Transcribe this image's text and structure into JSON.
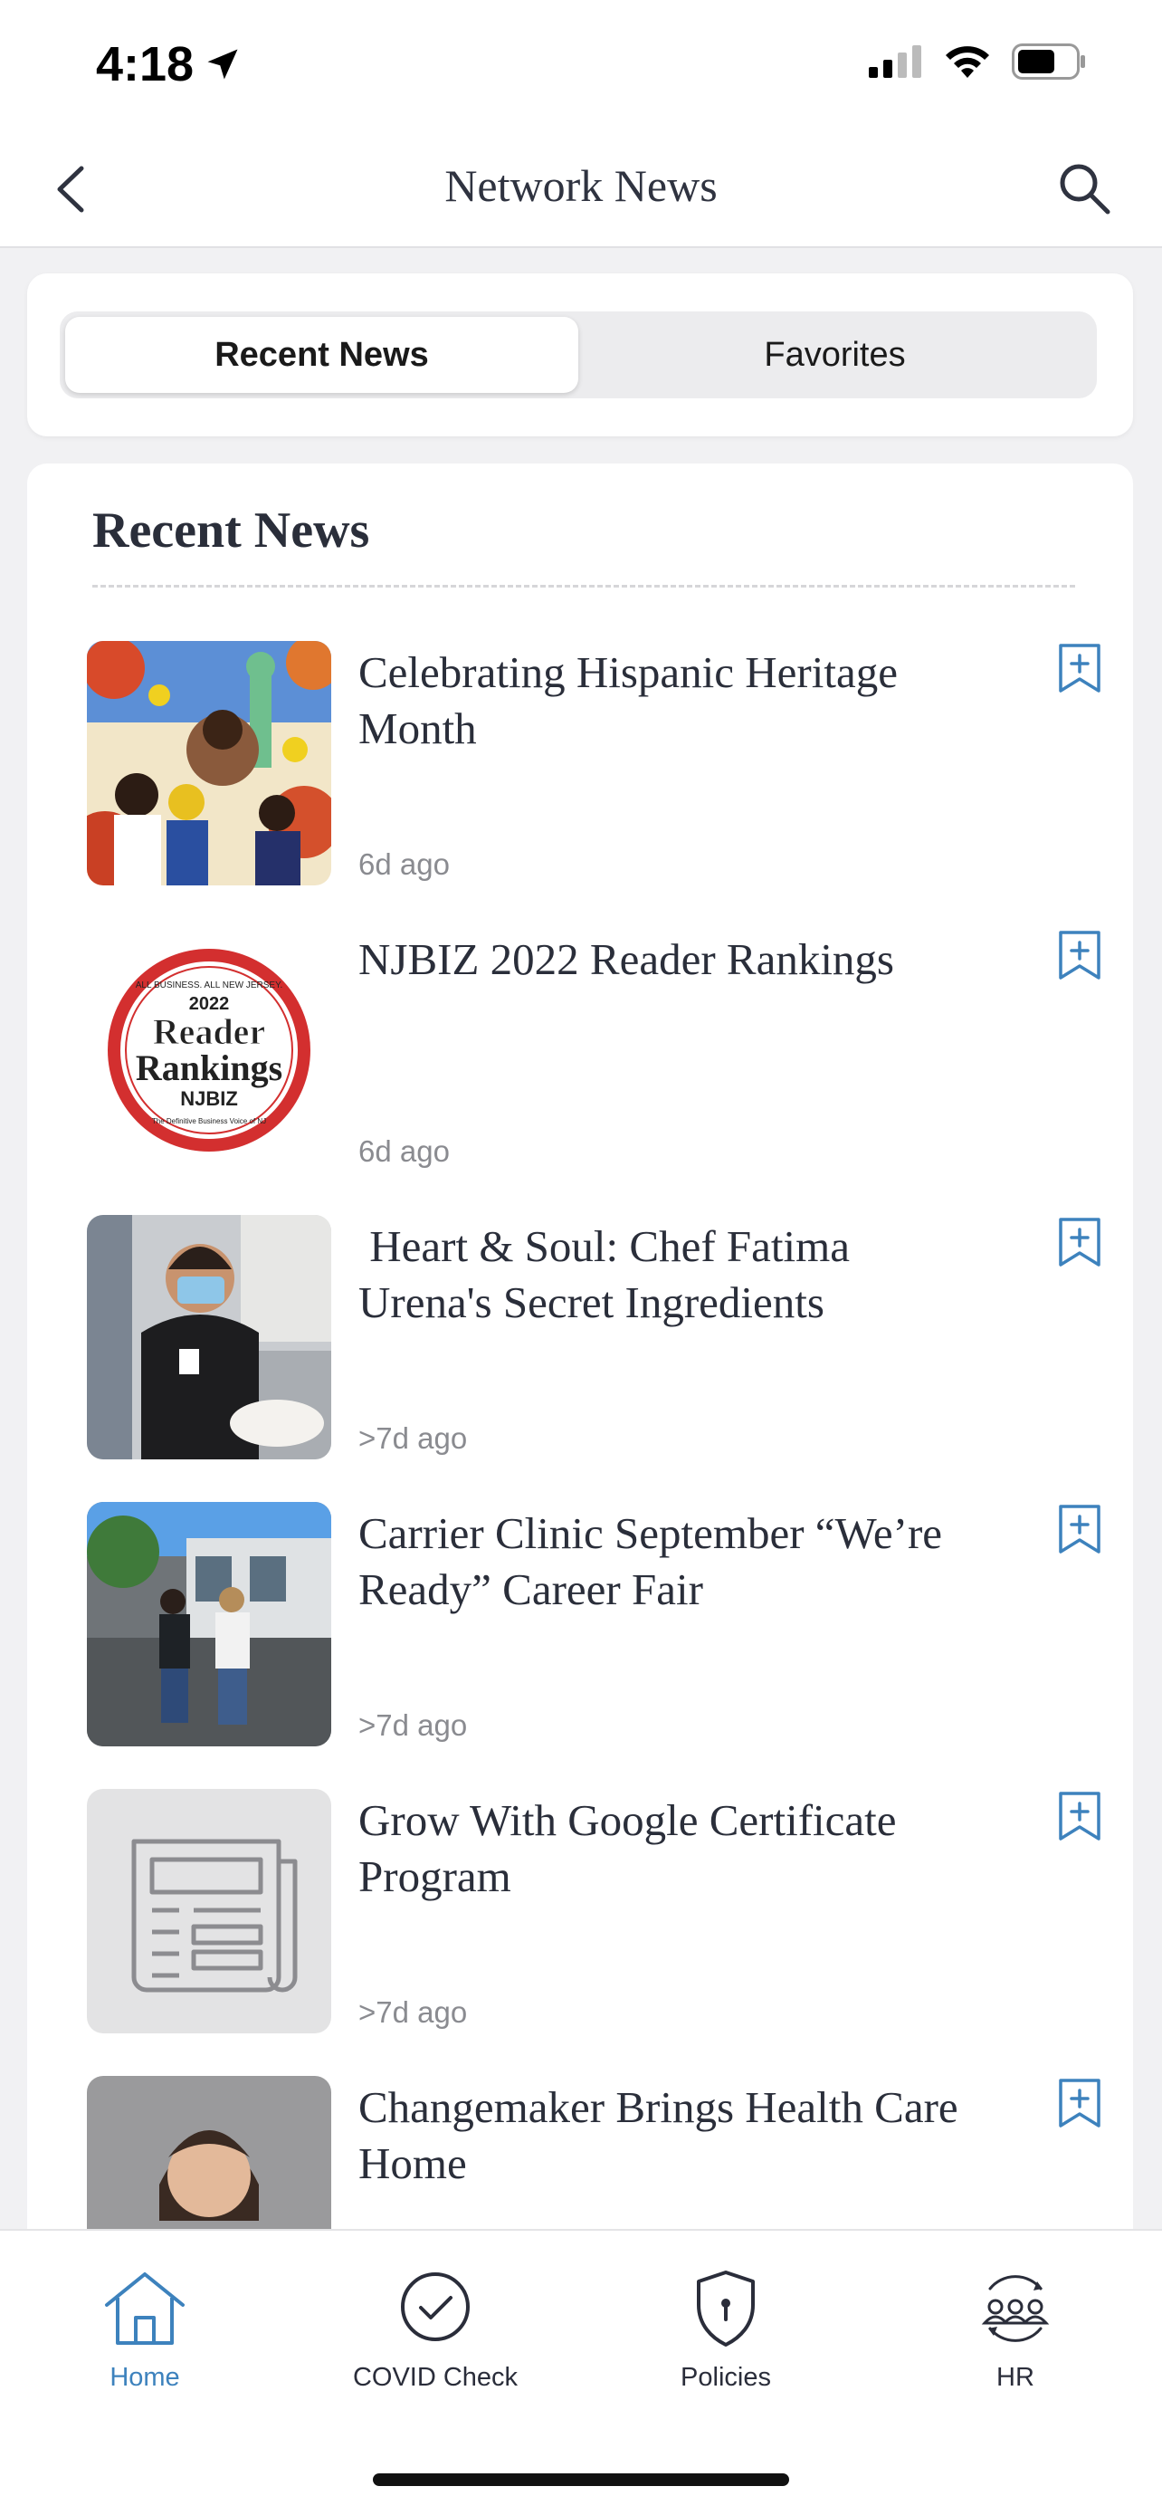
{
  "status_bar": {
    "time": "4:18"
  },
  "nav": {
    "title": "Network News"
  },
  "segments": {
    "recent": "Recent News",
    "favorites": "Favorites"
  },
  "news": {
    "heading": "Recent News",
    "items": [
      {
        "title": "Celebrating Hispanic Heritage Month",
        "time": "6d ago"
      },
      {
        "title": "NJBIZ 2022 Reader Rankings",
        "time": "6d ago"
      },
      {
        "title": " Heart & Soul: Chef Fatima Urena's Secret Ingredients",
        "time": ">7d ago"
      },
      {
        "title": "Carrier Clinic September “We’re Ready” Career Fair",
        "time": ">7d ago"
      },
      {
        "title": "Grow With Google Certificate Program",
        "time": ">7d ago"
      },
      {
        "title": "Changemaker Brings Health Care Home",
        "time": ""
      }
    ],
    "badge": {
      "top_text": "ALL BUSINESS. ALL NEW JERSEY.",
      "year": "2022",
      "line1": "Reader",
      "line2": "Rankings",
      "brand": "NJBIZ",
      "bottom_text": "The Definitive Business Voice of NJ"
    }
  },
  "tabs": [
    {
      "label": "Home",
      "icon": "home-icon"
    },
    {
      "label": "COVID Check",
      "icon": "check-circle-icon"
    },
    {
      "label": "Policies",
      "icon": "shield-icon"
    },
    {
      "label": "HR",
      "icon": "people-cycle-icon"
    }
  ],
  "colors": {
    "accent": "#3d82bd",
    "text": "#2a2e3a",
    "muted": "#8a8b90",
    "badge_red": "#d32f2f"
  }
}
